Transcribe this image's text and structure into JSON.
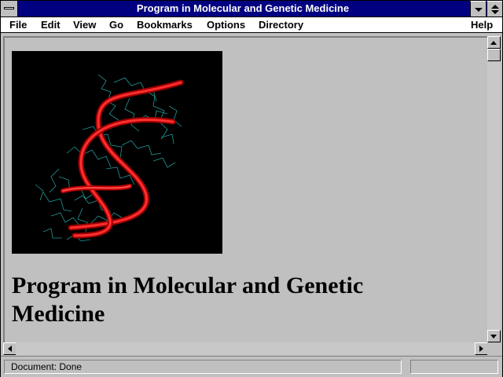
{
  "window": {
    "title": "Program in Molecular and Genetic Medicine"
  },
  "menu": [
    {
      "label": "File"
    },
    {
      "label": "Edit"
    },
    {
      "label": "View"
    },
    {
      "label": "Go"
    },
    {
      "label": "Bookmarks"
    },
    {
      "label": "Options"
    },
    {
      "label": "Directory"
    },
    {
      "label": "Help"
    }
  ],
  "page": {
    "heading": "Program in Molecular and Genetic Medicine",
    "image": {
      "icon": "dna-double-helix-image",
      "background": "#000000",
      "helix_color": "#dd1111",
      "wire_color": "#2aa8a8"
    }
  },
  "status": {
    "text": "Document: Done",
    "progress": 0
  },
  "colors": {
    "titlebar": "#000080",
    "chrome": "#c0c0c0",
    "menubar": "#ffffff"
  }
}
